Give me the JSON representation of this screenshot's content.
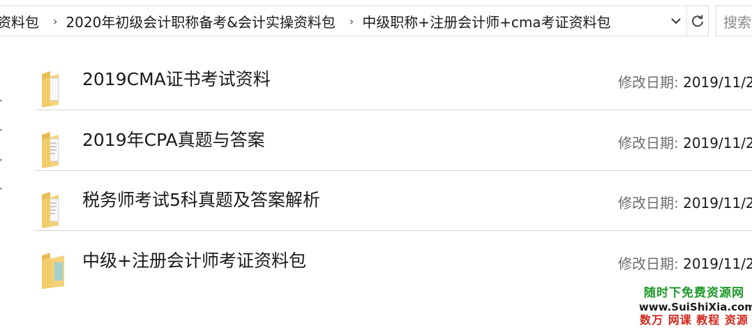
{
  "breadcrumb": {
    "items": [
      "资料包",
      "2020年初级会计职称备考&会计实操资料包",
      "中级职称+注册会计师+cma考证资料包"
    ],
    "separator": "›",
    "dropdown_icon": "chevron-down-icon",
    "refresh_icon": "refresh-icon"
  },
  "search": {
    "placeholder": "搜索"
  },
  "files": [
    {
      "name": "2019CMA证书考试资料",
      "date_label": "修改日期:",
      "date_value": "2019/11/2"
    },
    {
      "name": "2019年CPA真题与答案",
      "date_label": "修改日期:",
      "date_value": "2019/11/2"
    },
    {
      "name": "税务师考试5科真题及答案解析",
      "date_label": "修改日期:",
      "date_value": "2019/11/2"
    },
    {
      "name": "中级+注册会计师考证资料包",
      "date_label": "修改日期:",
      "date_value": "2019/11/2"
    }
  ],
  "watermark": {
    "line1": "随时下免费资源网",
    "line2": "www.SuiShiXia.com",
    "line3": "数万 网课 教程 资源"
  },
  "colors": {
    "folder_body": "#f3d27a",
    "folder_tab": "#e8bd55",
    "divider": "#d4d4d4",
    "watermark_green": "#1f9a2a",
    "watermark_red": "#d0281e"
  }
}
